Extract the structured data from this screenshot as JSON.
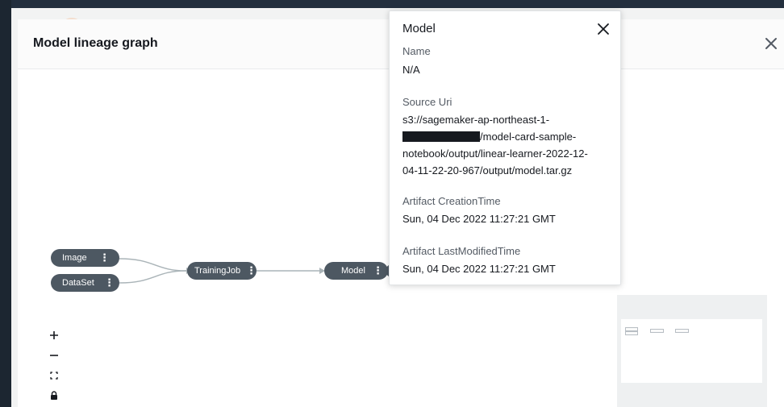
{
  "modal": {
    "title": "Model lineage graph"
  },
  "graph": {
    "nodes": [
      {
        "id": "image",
        "label": "Image"
      },
      {
        "id": "dataset",
        "label": "DataSet"
      },
      {
        "id": "trainingjob",
        "label": "TrainingJob"
      },
      {
        "id": "model",
        "label": "Model"
      }
    ],
    "node_menu_glyph": "⋮",
    "edge_color": "#aab4b8",
    "node_color": "#4d5862"
  },
  "popover": {
    "title": "Model",
    "fields": [
      {
        "label": "Name",
        "value": "N/A"
      },
      {
        "label": "Source Uri",
        "value_lines": [
          "s3://sagemaker-ap-northeast-1-",
          "/model-card-sample-",
          "notebook/output/linear-learner-2022-12-",
          "04-11-22-20-967/output/model.tar.gz"
        ]
      },
      {
        "label": "Artifact CreationTime",
        "value": "Sun, 04 Dec 2022 11:27:21 GMT"
      },
      {
        "label": "Artifact LastModifiedTime",
        "value": "Sun, 04 Dec 2022 11:27:21 GMT"
      }
    ]
  },
  "controls": {
    "zoom_in": "zoom-in-icon",
    "zoom_out": "zoom-out-icon",
    "fit_view": "fit-view-icon",
    "lock": "lock-icon"
  }
}
